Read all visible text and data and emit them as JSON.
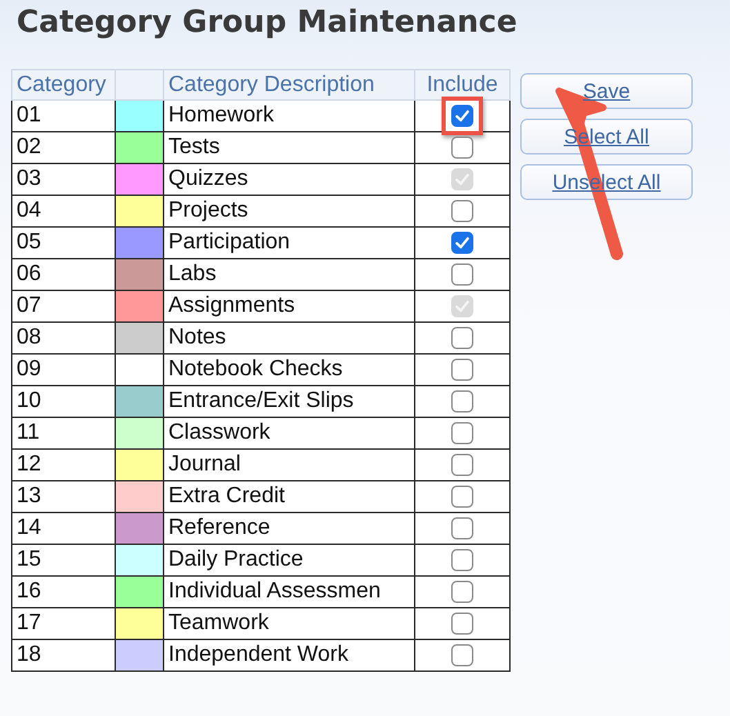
{
  "title": "Category Group Maintenance",
  "columns": [
    "Category",
    "",
    "Category Description",
    "Include"
  ],
  "rows": [
    {
      "code": "01",
      "color": "#99ffff",
      "description": "Homework",
      "checked": true,
      "disabled": false,
      "highlighted": true
    },
    {
      "code": "02",
      "color": "#99ff99",
      "description": "Tests",
      "checked": false,
      "disabled": false,
      "highlighted": false
    },
    {
      "code": "03",
      "color": "#ff99ff",
      "description": "Quizzes",
      "checked": true,
      "disabled": true,
      "highlighted": false
    },
    {
      "code": "04",
      "color": "#ffff99",
      "description": "Projects",
      "checked": false,
      "disabled": false,
      "highlighted": false
    },
    {
      "code": "05",
      "color": "#9999ff",
      "description": "Participation",
      "checked": true,
      "disabled": false,
      "highlighted": false
    },
    {
      "code": "06",
      "color": "#cc9999",
      "description": "Labs",
      "checked": false,
      "disabled": false,
      "highlighted": false
    },
    {
      "code": "07",
      "color": "#ff9999",
      "description": "Assignments",
      "checked": true,
      "disabled": true,
      "highlighted": false
    },
    {
      "code": "08",
      "color": "#cccccc",
      "description": "Notes",
      "checked": false,
      "disabled": false,
      "highlighted": false
    },
    {
      "code": "09",
      "color": "#ffffff",
      "description": "Notebook Checks",
      "checked": false,
      "disabled": false,
      "highlighted": false
    },
    {
      "code": "10",
      "color": "#99cccc",
      "description": "Entrance/Exit Slips",
      "checked": false,
      "disabled": false,
      "highlighted": false
    },
    {
      "code": "11",
      "color": "#ccffcc",
      "description": "Classwork",
      "checked": false,
      "disabled": false,
      "highlighted": false
    },
    {
      "code": "12",
      "color": "#ffff99",
      "description": "Journal",
      "checked": false,
      "disabled": false,
      "highlighted": false
    },
    {
      "code": "13",
      "color": "#ffcccc",
      "description": "Extra Credit",
      "checked": false,
      "disabled": false,
      "highlighted": false
    },
    {
      "code": "14",
      "color": "#cc99cc",
      "description": "Reference",
      "checked": false,
      "disabled": false,
      "highlighted": false
    },
    {
      "code": "15",
      "color": "#ccffff",
      "description": "Daily Practice",
      "checked": false,
      "disabled": false,
      "highlighted": false
    },
    {
      "code": "16",
      "color": "#99ff99",
      "description": "Individual Assessmen",
      "checked": false,
      "disabled": false,
      "highlighted": false
    },
    {
      "code": "17",
      "color": "#ffff99",
      "description": "Teamwork",
      "checked": false,
      "disabled": false,
      "highlighted": false
    },
    {
      "code": "18",
      "color": "#ccccff",
      "description": "Independent Work",
      "checked": false,
      "disabled": false,
      "highlighted": false
    }
  ],
  "buttons": [
    "Save",
    "Select All",
    "Unselect All"
  ],
  "annotation": {
    "kind": "arrow"
  }
}
